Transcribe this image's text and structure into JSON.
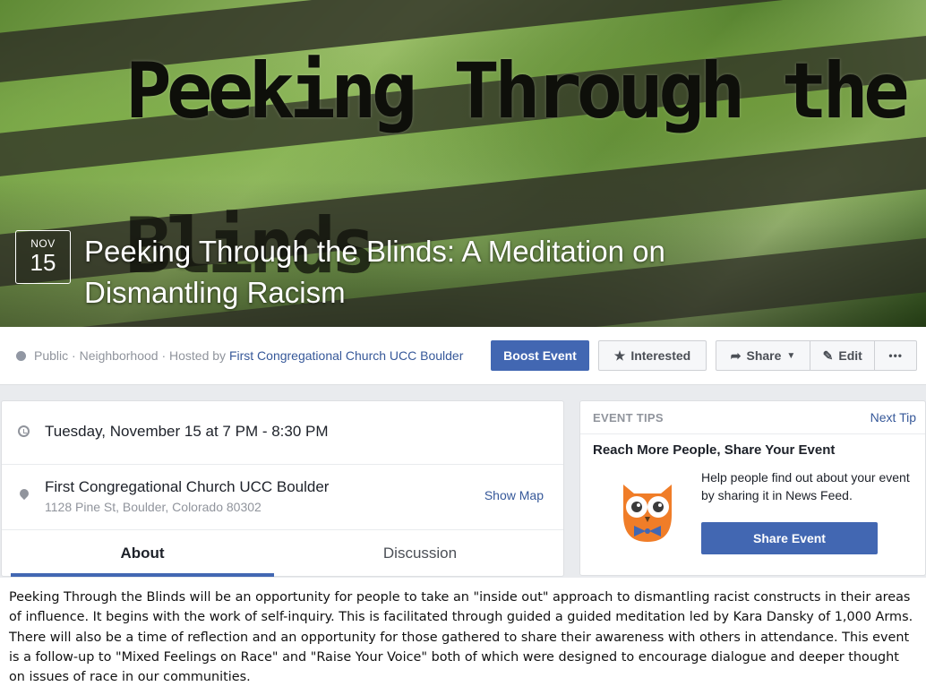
{
  "cover": {
    "image_title_line1": "Peeking Through the",
    "image_title_line2": "Blinds",
    "date_month": "NOV",
    "date_day": "15",
    "event_title": "Peeking Through the Blinds: A Meditation on Dismantling Racism"
  },
  "actionbar": {
    "privacy": "Public",
    "sep1": " · ",
    "category": "Neighborhood",
    "sep2": " · Hosted by ",
    "host": "First Congregational Church UCC Boulder",
    "boost_label": "Boost Event",
    "interested_label": "Interested",
    "share_label": "Share",
    "edit_label": "Edit",
    "more_label": "•••"
  },
  "details": {
    "datetime": "Tuesday, November 15 at 7 PM - 8:30 PM",
    "location_name": "First Congregational Church UCC Boulder",
    "location_address": "1128 Pine St, Boulder, Colorado 80302",
    "show_map_label": "Show Map",
    "tabs": [
      {
        "label": "About"
      },
      {
        "label": "Discussion"
      }
    ]
  },
  "tips": {
    "header": "EVENT TIPS",
    "next_tip": "Next Tip",
    "title": "Reach More People, Share Your Event",
    "text": "Help people find out about your event by sharing it in News Feed.",
    "button": "Share Event"
  },
  "description": "Peeking Through the Blinds will be an opportunity for people to take an \"inside out\" approach to dismantling racist constructs in their areas of influence. It begins with the work of self-inquiry. This is facilitated through guided a guided meditation led by Kara Dansky of 1,000 Arms. There will also be a time of reflection and an opportunity for those gathered to share their awareness with others in attendance. This event is a follow-up to \"Mixed Feelings on Race\" and \"Raise Your Voice\" both of which were designed to encourage dialogue and deeper thought on issues of race in our communities.",
  "colors": {
    "primary_blue": "#4267b2",
    "link_blue": "#365899",
    "owl_orange": "#f07d28"
  }
}
